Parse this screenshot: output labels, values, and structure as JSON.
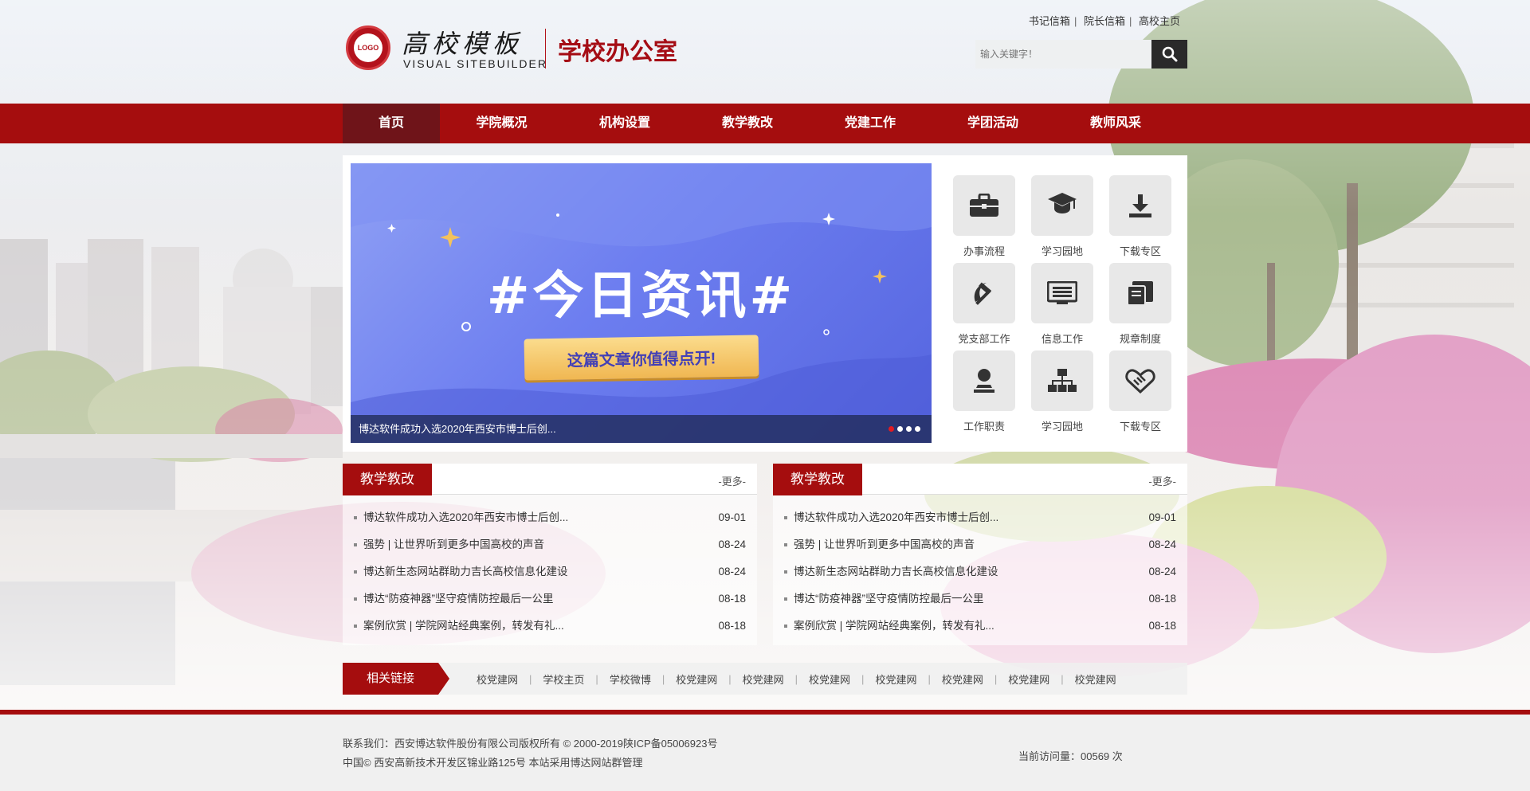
{
  "header": {
    "logo_seal_text": "LOGO",
    "logo_cn": "高校模板",
    "logo_en": "VISUAL  SITEBUILDER",
    "site_name": "学校办公室",
    "top_links": [
      "书记信箱",
      "院长信箱",
      "高校主页"
    ],
    "search_placeholder": "输入关键字！"
  },
  "nav": {
    "items": [
      "首页",
      "学院概况",
      "机构设置",
      "教学教改",
      "党建工作",
      "学团活动",
      "教师风采"
    ],
    "active": 0
  },
  "banner": {
    "title": "#今日资讯#",
    "button": "这篇文章你值得点开!",
    "caption": "博达软件成功入选2020年西安市博士后创...",
    "slide_count": 4,
    "current_slide": 1
  },
  "quick_links": [
    {
      "label": "办事流程",
      "icon": "briefcase-icon"
    },
    {
      "label": "学习园地",
      "icon": "graduation-cap-icon"
    },
    {
      "label": "下载专区",
      "icon": "download-icon"
    },
    {
      "label": "党支部工作",
      "icon": "hammer-sickle-icon"
    },
    {
      "label": "信息工作",
      "icon": "news-icon"
    },
    {
      "label": "规章制度",
      "icon": "book-icon"
    },
    {
      "label": "工作职责",
      "icon": "user-stamp-icon"
    },
    {
      "label": "学习园地",
      "icon": "sitemap-icon"
    },
    {
      "label": "下载专区",
      "icon": "handshake-icon"
    }
  ],
  "news_left": {
    "title": "教学教改",
    "more": "-更多-",
    "items": [
      {
        "title": "博达软件成功入选2020年西安市博士后创...",
        "date": "09-01"
      },
      {
        "title": "强势 | 让世界听到更多中国高校的声音",
        "date": "08-24"
      },
      {
        "title": "博达新生态网站群助力吉长高校信息化建设",
        "date": "08-24"
      },
      {
        "title": "博达“防疫神器”坚守疫情防控最后一公里",
        "date": "08-18"
      },
      {
        "title": "案例欣赏 | 学院网站经典案例，转发有礼...",
        "date": "08-18"
      }
    ]
  },
  "news_right": {
    "title": "教学教改",
    "more": "-更多-",
    "items": [
      {
        "title": "博达软件成功入选2020年西安市博士后创...",
        "date": "09-01"
      },
      {
        "title": "强势 | 让世界听到更多中国高校的声音",
        "date": "08-24"
      },
      {
        "title": "博达新生态网站群助力吉长高校信息化建设",
        "date": "08-24"
      },
      {
        "title": "博达“防疫神器”坚守疫情防控最后一公里",
        "date": "08-18"
      },
      {
        "title": "案例欣赏 | 学院网站经典案例，转发有礼...",
        "date": "08-18"
      }
    ]
  },
  "related_links": {
    "title": "相关链接",
    "items": [
      "校党建网",
      "学校主页",
      "学校微博",
      "校党建网",
      "校党建网",
      "校党建网",
      "校党建网",
      "校党建网",
      "校党建网",
      "校党建网"
    ]
  },
  "footer": {
    "line1": "联系我们：西安博达软件股份有限公司版权所有 © 2000-2019陕ICP备05006923号",
    "line2": "中国© 西安高新技术开发区锦业路125号 本站采用博达网站群管理",
    "visits": "当前访问量：00569 次"
  },
  "colors": {
    "brand_red": "#a50d0e",
    "nav_active": "#6f1419",
    "dark_button": "#2a2a2a"
  }
}
